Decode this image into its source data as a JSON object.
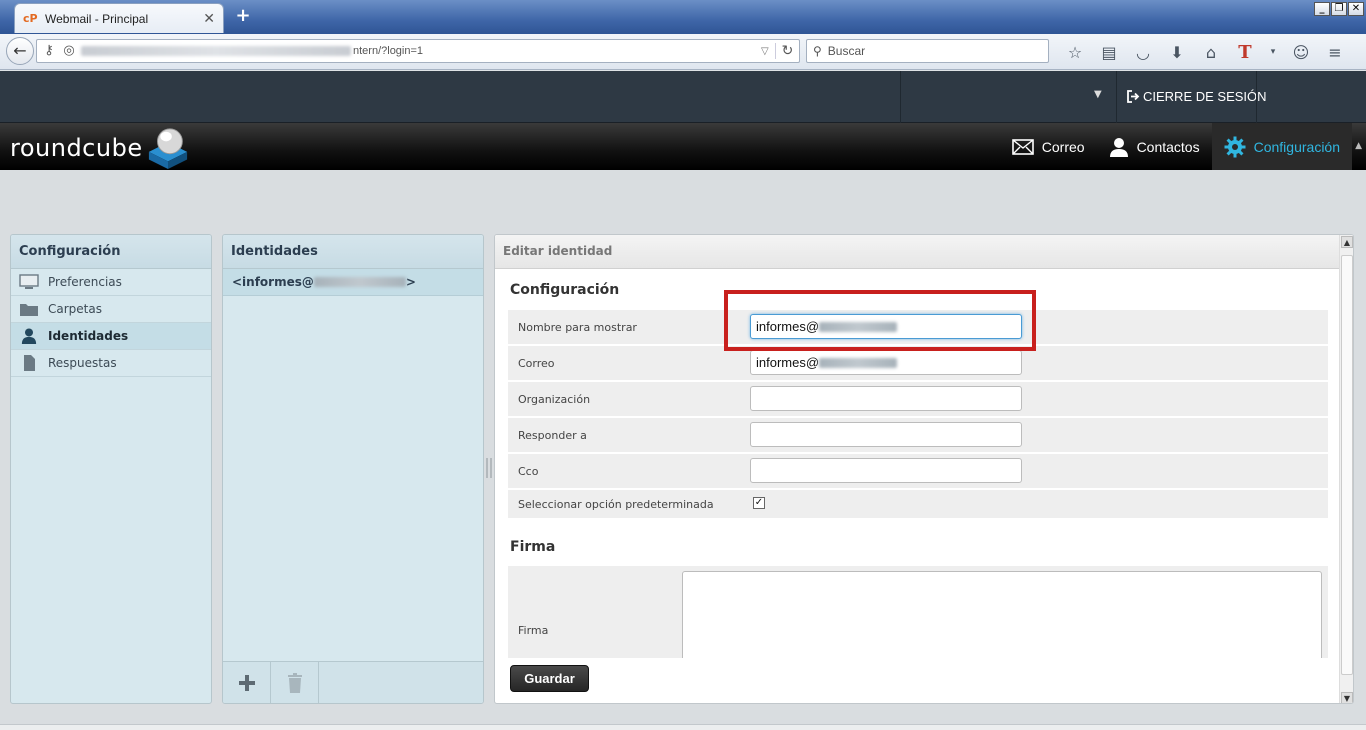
{
  "browser": {
    "tab_title": "Webmail - Principal",
    "tab_favicon": "cP",
    "url_visible": "ntern/?login=1",
    "search_placeholder": "Buscar",
    "toolbar_icons": [
      "star-icon",
      "reading-list-icon",
      "pocket-icon",
      "download-icon",
      "home-icon",
      "t-icon",
      "menu-drop-icon",
      "chat-icon",
      "hamburger-icon"
    ]
  },
  "topline": {
    "logout_label": "CIERRE DE SESIÓN"
  },
  "header": {
    "logo_text": "roundcube",
    "tabs": [
      {
        "label": "Correo",
        "icon": "mail-icon"
      },
      {
        "label": "Contactos",
        "icon": "person-icon"
      },
      {
        "label": "Configuración",
        "icon": "gear-icon",
        "selected": true
      }
    ]
  },
  "settings_panel": {
    "title": "Configuración",
    "items": [
      {
        "label": "Preferencias",
        "icon": "monitor-icon"
      },
      {
        "label": "Carpetas",
        "icon": "folder-icon"
      },
      {
        "label": "Identidades",
        "icon": "user-icon",
        "selected": true
      },
      {
        "label": "Respuestas",
        "icon": "document-icon"
      }
    ]
  },
  "identities_panel": {
    "title": "Identidades",
    "items": [
      {
        "label_prefix": "<informes@",
        "label_suffix": ">"
      }
    ]
  },
  "editor": {
    "title": "Editar identidad",
    "section_config": "Configuración",
    "fields": {
      "display_name": {
        "label": "Nombre para mostrar",
        "value_prefix": "informes@"
      },
      "email": {
        "label": "Correo",
        "value_prefix": "informes@"
      },
      "organization": {
        "label": "Organización",
        "value": ""
      },
      "reply_to": {
        "label": "Responder a",
        "value": ""
      },
      "bcc": {
        "label": "Cco",
        "value": ""
      },
      "default": {
        "label": "Seleccionar opción predeterminada",
        "checked": true
      }
    },
    "section_signature": "Firma",
    "signature_label": "Firma",
    "save_label": "Guardar"
  },
  "colors": {
    "highlight_border": "#c8201d",
    "selected_tab": "#30b6e0"
  }
}
